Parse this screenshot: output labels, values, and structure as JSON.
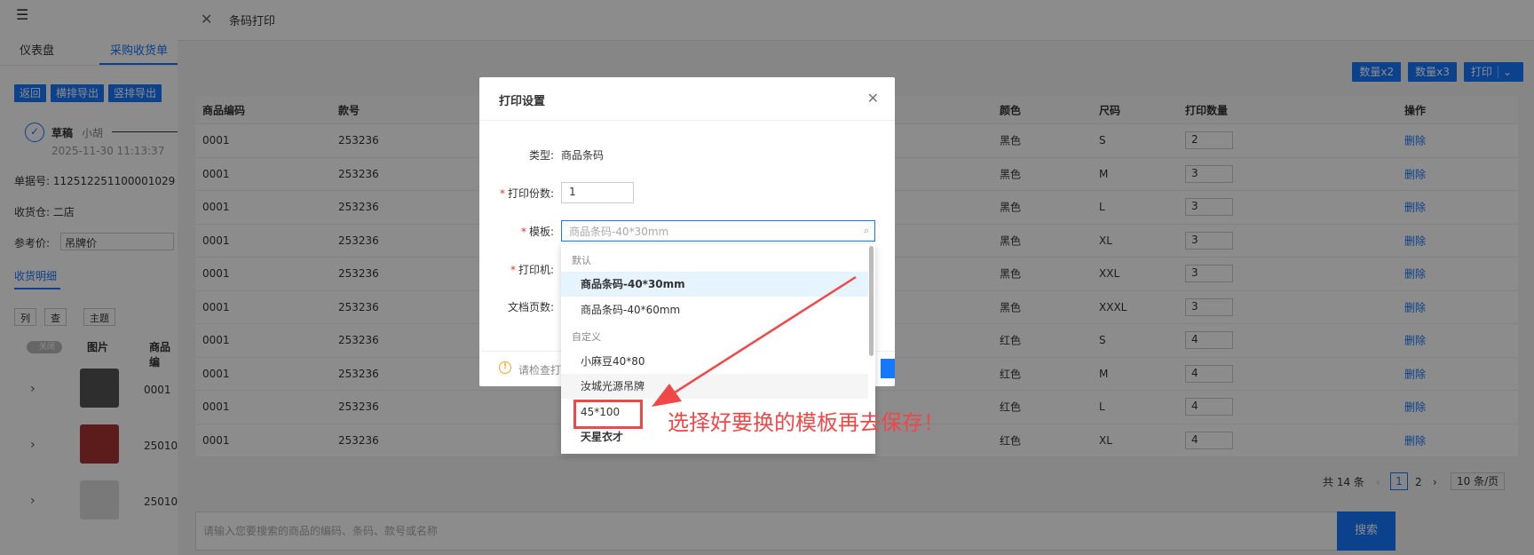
{
  "left": {
    "tabs": [
      "仪表盘",
      "采购收货单"
    ],
    "buttons": [
      "返回",
      "横排导出",
      "竖排导出"
    ],
    "status": {
      "title": "草稿",
      "user": "小胡",
      "time": "2025-11-30 11:13:37"
    },
    "doc_no": "单据号: 112512251100001029",
    "warehouse": "收货仓: 二店",
    "ref_price_label": "参考价:",
    "ref_price_value": "吊牌价",
    "detail_tab": "收货明细",
    "mini_buttons": [
      "列",
      "查",
      "主题"
    ],
    "toggle_label": "关闭",
    "col_heads": [
      "图片",
      "商品编"
    ],
    "rows": [
      "0001",
      "25010",
      "25010"
    ]
  },
  "drawer": {
    "title": "条码打印",
    "top_buttons": [
      "数量x2",
      "数量x3",
      "打印"
    ],
    "columns": [
      "商品编码",
      "款号",
      "颜色",
      "尺码",
      "打印数量",
      "操作"
    ],
    "rows": [
      {
        "code": "0001",
        "style": "253236",
        "color": "黑色",
        "size": "S",
        "qty": "2",
        "op": "删除"
      },
      {
        "code": "0001",
        "style": "253236",
        "color": "黑色",
        "size": "M",
        "qty": "3",
        "op": "删除"
      },
      {
        "code": "0001",
        "style": "253236",
        "color": "黑色",
        "size": "L",
        "qty": "3",
        "op": "删除"
      },
      {
        "code": "0001",
        "style": "253236",
        "color": "黑色",
        "size": "XL",
        "qty": "3",
        "op": "删除"
      },
      {
        "code": "0001",
        "style": "253236",
        "color": "黑色",
        "size": "XXL",
        "qty": "3",
        "op": "删除"
      },
      {
        "code": "0001",
        "style": "253236",
        "color": "黑色",
        "size": "XXXL",
        "qty": "3",
        "op": "删除"
      },
      {
        "code": "0001",
        "style": "253236",
        "color": "红色",
        "size": "S",
        "qty": "4",
        "op": "删除"
      },
      {
        "code": "0001",
        "style": "253236",
        "color": "红色",
        "size": "M",
        "qty": "4",
        "op": "删除"
      },
      {
        "code": "0001",
        "style": "253236",
        "color": "红色",
        "size": "L",
        "qty": "4",
        "op": "删除"
      },
      {
        "code": "0001",
        "style": "253236",
        "color": "红色",
        "size": "XL",
        "qty": "4",
        "op": "删除"
      }
    ],
    "pager": {
      "total": "共 14 条",
      "page1": "1",
      "page2": "2",
      "size": "10 条/页"
    },
    "search_placeholder": "请输入您要搜索的商品的编码、条码、款号或名称",
    "search_button": "搜索"
  },
  "modal": {
    "title": "打印设置",
    "type_label": "类型:",
    "type_value": "商品条码",
    "copies_label": "打印份数:",
    "copies_value": "1",
    "template_label": "模板:",
    "template_placeholder": "商品条码-40*30mm",
    "printer_label": "打印机:",
    "pages_label": "文档页数:",
    "warning": "请检查打"
  },
  "dropdown": {
    "group_default": "默认",
    "group_custom": "自定义",
    "items": [
      "商品条码-40*30mm",
      "商品条码-40*60mm",
      "小麻豆40*80",
      "汝城光源吊牌",
      "45*100",
      "天星衣才"
    ]
  },
  "annotation": "选择好要换的模板再去保存！",
  "colors": {
    "primary": "#1677ff",
    "danger": "#f04848",
    "warning": "#f5a623"
  }
}
